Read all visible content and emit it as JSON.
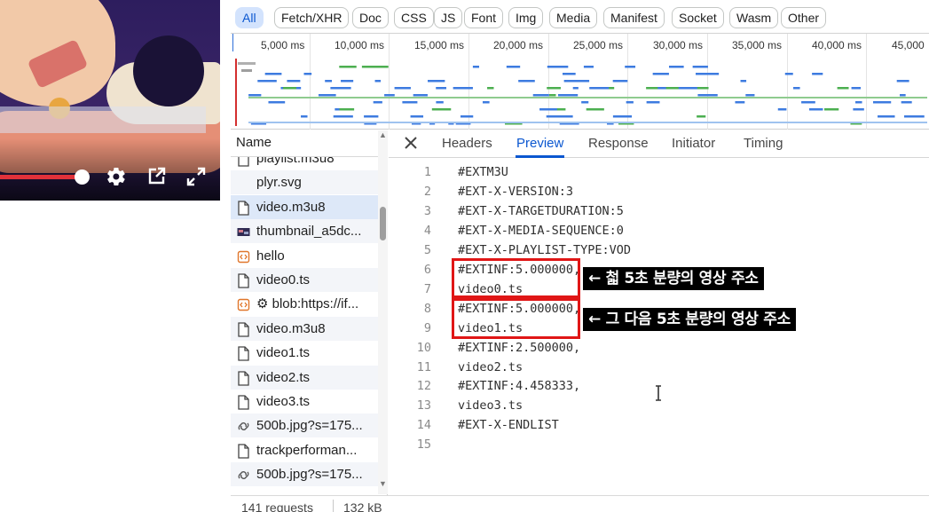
{
  "colors": {
    "accent": "#0b57d0",
    "chip_selected_bg": "#d3e3fd",
    "highlight": "#e01616",
    "note_bg": "#000000"
  },
  "filters": [
    "All",
    "Fetch/XHR",
    "Doc",
    "CSS",
    "JS",
    "Font",
    "Img",
    "Media",
    "Manifest",
    "Socket",
    "Wasm",
    "Other"
  ],
  "selected_filter": "All",
  "timeline_ticks": [
    "5,000 ms",
    "10,000 ms",
    "15,000 ms",
    "20,000 ms",
    "25,000 ms",
    "30,000 ms",
    "35,000 ms",
    "40,000 ms",
    "45,000"
  ],
  "request_list": {
    "header": "Name",
    "rows": [
      {
        "name": "playlist.m3u8",
        "icon": "document-icon"
      },
      {
        "name": "plyr.svg",
        "icon": "none"
      },
      {
        "name": "video.m3u8",
        "icon": "document-icon"
      },
      {
        "name": "thumbnail_a5dc...",
        "icon": "image-thumbnail-icon"
      },
      {
        "name": "hello",
        "icon": "script-icon"
      },
      {
        "name": "video0.ts",
        "icon": "document-icon"
      },
      {
        "name": "⚙ blob:https://if...",
        "icon": "script-icon"
      },
      {
        "name": "video.m3u8",
        "icon": "document-icon"
      },
      {
        "name": "video1.ts",
        "icon": "document-icon"
      },
      {
        "name": "video2.ts",
        "icon": "document-icon"
      },
      {
        "name": "video3.ts",
        "icon": "document-icon"
      },
      {
        "name": "500b.jpg?s=175...",
        "icon": "link-icon"
      },
      {
        "name": "trackperforman...",
        "icon": "document-icon"
      },
      {
        "name": "500b.jpg?s=175...",
        "icon": "link-icon"
      }
    ],
    "selected_index": 2
  },
  "status": {
    "requests": "141 requests",
    "size": "132 kB"
  },
  "details": {
    "tabs": [
      "Headers",
      "Preview",
      "Response",
      "Initiator",
      "Timing"
    ],
    "active_tab": "Preview",
    "lines": [
      "#EXTM3U",
      "#EXT-X-VERSION:3",
      "#EXT-X-TARGETDURATION:5",
      "#EXT-X-MEDIA-SEQUENCE:0",
      "#EXT-X-PLAYLIST-TYPE:VOD",
      "#EXTINF:5.000000,",
      "video0.ts",
      "#EXTINF:5.000000,",
      "video1.ts",
      "#EXTINF:2.500000,",
      "video2.ts",
      "#EXTINF:4.458333,",
      "video3.ts",
      "#EXT-X-ENDLIST",
      ""
    ],
    "line_numbers": [
      "1",
      "2",
      "3",
      "4",
      "5",
      "6",
      "7",
      "8",
      "9",
      "10",
      "11",
      "12",
      "13",
      "14",
      "15"
    ]
  },
  "annotations": [
    "← 첣 5초 분량의 영상 주소",
    "← 그 다음 5초 분량의 영상 주소"
  ],
  "video_player": {
    "icons": [
      "settings-gear-icon",
      "open-external-icon",
      "fullscreen-icon"
    ]
  }
}
